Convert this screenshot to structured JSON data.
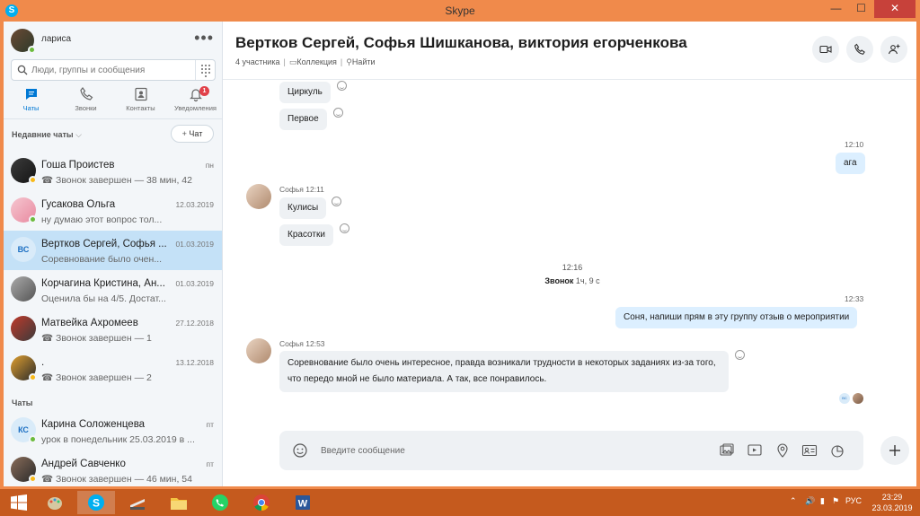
{
  "window": {
    "title": "Skype"
  },
  "profile": {
    "name": "лариса"
  },
  "search": {
    "placeholder": "Люди, группы и сообщения"
  },
  "nav": {
    "tabs": [
      {
        "label": "Чаты",
        "icon": "chat-icon"
      },
      {
        "label": "Звонки",
        "icon": "phone-icon"
      },
      {
        "label": "Контакты",
        "icon": "contacts-icon"
      },
      {
        "label": "Уведомления",
        "icon": "bell-icon"
      }
    ],
    "notification_count": "1"
  },
  "sidebar": {
    "recent_label": "Недавние чаты",
    "new_chat_label": "Чат",
    "chats_label": "Чаты",
    "recent_chats": [
      {
        "name": "Гоша Проистев",
        "date": "пн",
        "message": "Звонок завершен — 38 мин, 42"
      },
      {
        "name": "Гусакова Ольга",
        "date": "12.03.2019",
        "message": "ну думаю этот вопрос тол..."
      },
      {
        "name": "Вертков Сергей, Софья ...",
        "date": "01.03.2019",
        "message": "Соревнование было очен...",
        "initials": "ВС"
      },
      {
        "name": "Корчагина Кристина, Ан...",
        "date": "01.03.2019",
        "message": "Оценила бы на 4/5. Достат..."
      },
      {
        "name": "Матвейка Ахромеев",
        "date": "27.12.2018",
        "message": "Звонок завершен — 1"
      },
      {
        "name": ".",
        "date": "13.12.2018",
        "message": "Звонок завершен — 2"
      }
    ],
    "chats": [
      {
        "name": "Карина Соложенцева",
        "date": "пт",
        "message": "урок в понедельник 25.03.2019 в ...",
        "initials": "КС"
      },
      {
        "name": "Андрей Савченко",
        "date": "пт",
        "message": "Звонок завершен — 46 мин, 54"
      }
    ]
  },
  "conversation": {
    "title": "Вертков Сергей, Софья Шишканова, виктория егорченкова",
    "participants": "4 участника",
    "gallery": "Коллекция",
    "find": "Найти",
    "messages": [
      {
        "text": "Циркуль"
      },
      {
        "text": "Первое"
      },
      {
        "time": "12:10",
        "text": "ага"
      },
      {
        "sender": "Софья 12:11",
        "text": "Кулисы"
      },
      {
        "text": "Красотки"
      },
      {
        "call_time": "12:16",
        "call_label": "Звонок",
        "call_duration": "1ч, 9 с"
      },
      {
        "time": "12:33",
        "text": "Соня, напиши прям в эту группу отзыв о мероприятии"
      },
      {
        "sender": "Софья 12:53",
        "text": "Соревнование было очень интересное, правда возникали трудности в некоторых заданиях из-за того, что передо мной не было материала. А так, все понравилось."
      }
    ],
    "seen_initials": "ВС"
  },
  "composer": {
    "placeholder": "Введите сообщение"
  },
  "taskbar": {
    "language": "РУС",
    "time": "23:29",
    "date": "23.03.2019"
  },
  "colors": {
    "accent": "#0078d4",
    "frame": "#f08a4b",
    "taskbar": "#c55a1e",
    "selected": "#c4e1f7"
  }
}
